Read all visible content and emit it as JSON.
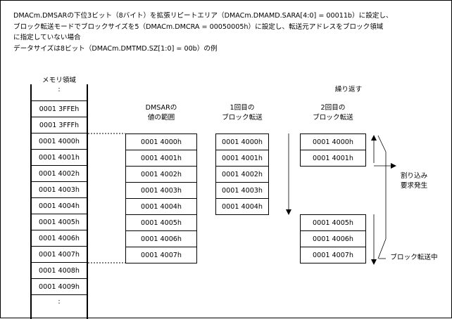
{
  "description": {
    "lines": [
      "DMACm.DMSARの下位3ビット（8バイト）を拡張リピートエリア（DMACm.DMAMD.SARA[4:0] = 00011b）に設定し、",
      "ブロック転送モードでブロックサイズを5（DMACm.DMCRA = 00050005h）に設定し、転送元アドレスをブロック領域",
      "に指定していない場合",
      "データサイズは8ビット（DMACm.DMTMD.SZ[1:0] = 00b）の例"
    ]
  },
  "memory": {
    "title": "メモリ領域",
    "dots_top": ":",
    "dots_bottom": ":",
    "rows": [
      "0001 3FFEh",
      "0001 3FFFh",
      "0001 4000h",
      "0001 4001h",
      "0001 4002h",
      "0001 4003h",
      "0001 4004h",
      "0001 4005h",
      "0001 4006h",
      "0001 4007h",
      "0001 4008h",
      "0001 4009h"
    ]
  },
  "dmsar_range": {
    "title_line1": "DMSARの",
    "title_line2": "値の範囲",
    "cells": [
      "0001 4000h",
      "0001 4001h",
      "0001 4002h",
      "0001 4003h",
      "0001 4004h",
      "0001 4005h",
      "0001 4006h",
      "0001 4007h"
    ]
  },
  "first_transfer": {
    "title_line1": "1回目の",
    "title_line2": "ブロック転送",
    "cells": [
      "0001 4000h",
      "0001 4001h",
      "0001 4002h",
      "0001 4003h",
      "0001 4004h"
    ]
  },
  "second_transfer": {
    "repeat_label": "繰り返す",
    "title_line1": "2回目の",
    "title_line2": "ブロック転送",
    "cells_top": [
      "0001 4000h",
      "0001 4001h"
    ],
    "cells_bottom": [
      "0001 4005h",
      "0001 4006h",
      "0001 4007h"
    ]
  },
  "annotations": {
    "interrupt_line1": "割り込み",
    "interrupt_line2": "要求発生",
    "in_transfer": "ブロック転送中"
  }
}
